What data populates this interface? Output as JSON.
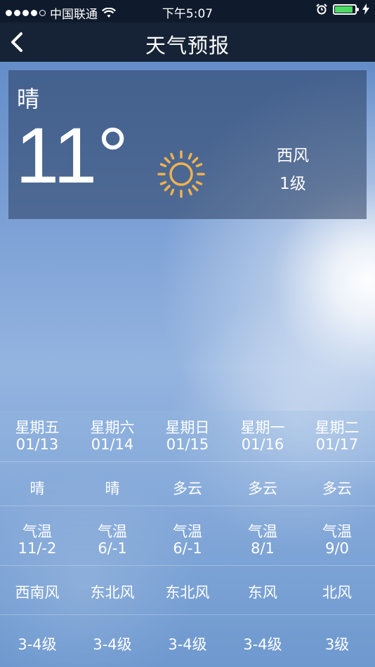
{
  "status_bar": {
    "carrier": "中国联通",
    "time": "下午5:07",
    "signal_strength": "4 of 5",
    "battery_level": 0.9,
    "battery_color": "#4cd964",
    "icons": [
      "signal-dots-icon",
      "wifi-icon",
      "alarm-icon",
      "battery-icon",
      "charging-bolt-icon"
    ]
  },
  "nav": {
    "title": "天气预报",
    "back_icon": "chevron-left-icon"
  },
  "current": {
    "condition": "晴",
    "temperature": "11°",
    "icon": "sun-icon",
    "icon_color": "#f2b24b",
    "wind_direction": "西风",
    "wind_level": "1级"
  },
  "forecast": [
    {
      "day": "星期五",
      "date": "01/13",
      "condition": "晴",
      "temp_label": "气温",
      "temp": "11/-2",
      "wind": "西南风",
      "level": "3-4级"
    },
    {
      "day": "星期六",
      "date": "01/14",
      "condition": "晴",
      "temp_label": "气温",
      "temp": "6/-1",
      "wind": "东北风",
      "level": "3-4级"
    },
    {
      "day": "星期日",
      "date": "01/15",
      "condition": "多云",
      "temp_label": "气温",
      "temp": "6/-1",
      "wind": "东北风",
      "level": "3-4级"
    },
    {
      "day": "星期一",
      "date": "01/16",
      "condition": "多云",
      "temp_label": "气温",
      "temp": "8/1",
      "wind": "东风",
      "level": "3-4级"
    },
    {
      "day": "星期二",
      "date": "01/17",
      "condition": "多云",
      "temp_label": "气温",
      "temp": "9/0",
      "wind": "北风",
      "level": "3级"
    }
  ]
}
